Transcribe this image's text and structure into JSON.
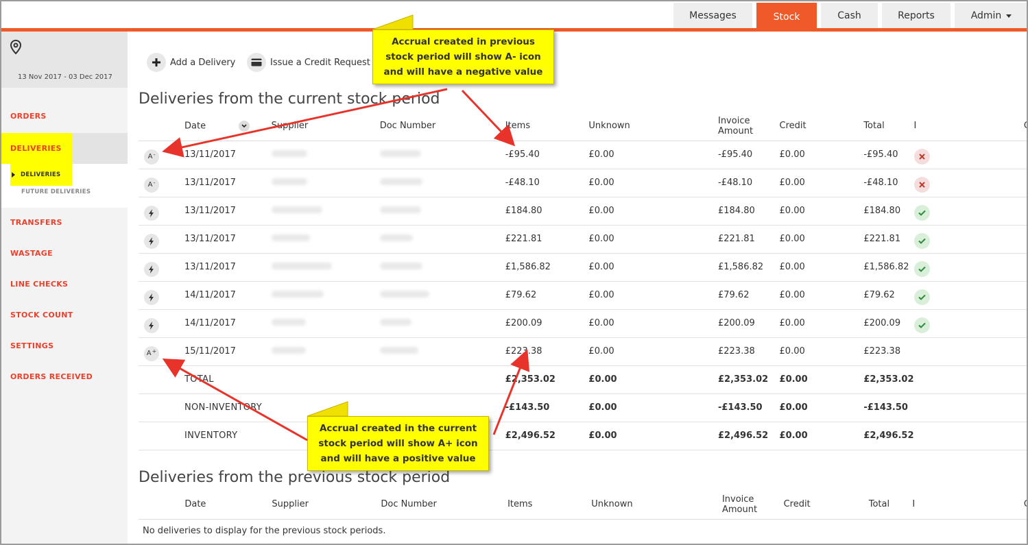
{
  "nav": {
    "tabs": [
      {
        "label": "Messages"
      },
      {
        "label": "Stock"
      },
      {
        "label": "Cash"
      },
      {
        "label": "Reports"
      },
      {
        "label": "Admin"
      }
    ]
  },
  "sidebar": {
    "date_range": "13 Nov 2017 - 03 Dec 2017",
    "items": {
      "orders": "ORDERS",
      "deliveries": "DELIVERIES",
      "sub_deliveries": "DELIVERIES",
      "sub_future": "FUTURE DELIVERIES",
      "transfers": "TRANSFERS",
      "wastage": "WASTAGE",
      "line_checks": "LINE CHECKS",
      "stock_count": "STOCK COUNT",
      "settings": "SETTINGS",
      "orders_received": "ORDERS RECEIVED"
    }
  },
  "actions": {
    "add_delivery": "Add a Delivery",
    "credit_request": "Issue a Credit Request"
  },
  "current": {
    "title": "Deliveries from the current stock period",
    "headers": [
      "Date",
      "Supplier",
      "Doc Number",
      "Items",
      "Unknown",
      "Invoice Amount",
      "Credit",
      "Total",
      "I",
      "C"
    ],
    "rows": [
      {
        "icon": "A",
        "sup": "-",
        "date": "13/11/2017",
        "items": "-£95.40",
        "unknown": "£0.00",
        "invoice": "-£95.40",
        "credit": "£0.00",
        "total": "-£95.40",
        "status": "x"
      },
      {
        "icon": "A",
        "sup": "-",
        "date": "13/11/2017",
        "items": "-£48.10",
        "unknown": "£0.00",
        "invoice": "-£48.10",
        "credit": "£0.00",
        "total": "-£48.10",
        "status": "x"
      },
      {
        "icon": "bolt",
        "sup": "",
        "date": "13/11/2017",
        "items": "£184.80",
        "unknown": "£0.00",
        "invoice": "£184.80",
        "credit": "£0.00",
        "total": "£184.80",
        "status": "ok"
      },
      {
        "icon": "bolt",
        "sup": "",
        "date": "13/11/2017",
        "items": "£221.81",
        "unknown": "£0.00",
        "invoice": "£221.81",
        "credit": "£0.00",
        "total": "£221.81",
        "status": "ok"
      },
      {
        "icon": "bolt",
        "sup": "",
        "date": "13/11/2017",
        "items": "£1,586.82",
        "unknown": "£0.00",
        "invoice": "£1,586.82",
        "credit": "£0.00",
        "total": "£1,586.82",
        "status": "ok"
      },
      {
        "icon": "bolt",
        "sup": "",
        "date": "14/11/2017",
        "items": "£79.62",
        "unknown": "£0.00",
        "invoice": "£79.62",
        "credit": "£0.00",
        "total": "£79.62",
        "status": "ok"
      },
      {
        "icon": "bolt",
        "sup": "",
        "date": "14/11/2017",
        "items": "£200.09",
        "unknown": "£0.00",
        "invoice": "£200.09",
        "credit": "£0.00",
        "total": "£200.09",
        "status": "ok"
      },
      {
        "icon": "A",
        "sup": "+",
        "date": "15/11/2017",
        "items": "£223.38",
        "unknown": "£0.00",
        "invoice": "£223.38",
        "credit": "£0.00",
        "total": "£223.38",
        "status": ""
      }
    ],
    "totals": [
      {
        "label": "TOTAL",
        "items": "£2,353.02",
        "unknown": "£0.00",
        "invoice": "£2,353.02",
        "credit": "£0.00",
        "total": "£2,353.02"
      },
      {
        "label": "NON-INVENTORY",
        "items": "-£143.50",
        "unknown": "£0.00",
        "invoice": "-£143.50",
        "credit": "£0.00",
        "total": "-£143.50"
      },
      {
        "label": "INVENTORY",
        "items": "£2,496.52",
        "unknown": "£0.00",
        "invoice": "£2,496.52",
        "credit": "£0.00",
        "total": "£2,496.52"
      }
    ]
  },
  "previous": {
    "title": "Deliveries from the previous stock period",
    "headers": [
      "Date",
      "Supplier",
      "Doc Number",
      "Items",
      "Unknown",
      "Invoice Amount",
      "Credit",
      "Total",
      "I",
      "C"
    ],
    "empty": "No deliveries to display for the previous stock periods."
  },
  "callouts": {
    "top": [
      "Accrual created in previous",
      "stock period will show A- icon",
      "and will have a negative value"
    ],
    "bottom": [
      "Accrual created in the current",
      "stock period will show A+ icon",
      "and will have a positive value"
    ]
  },
  "colors": {
    "accent": "#f05a28",
    "sidebar_red": "#e8412c",
    "highlight": "#ffff00"
  }
}
